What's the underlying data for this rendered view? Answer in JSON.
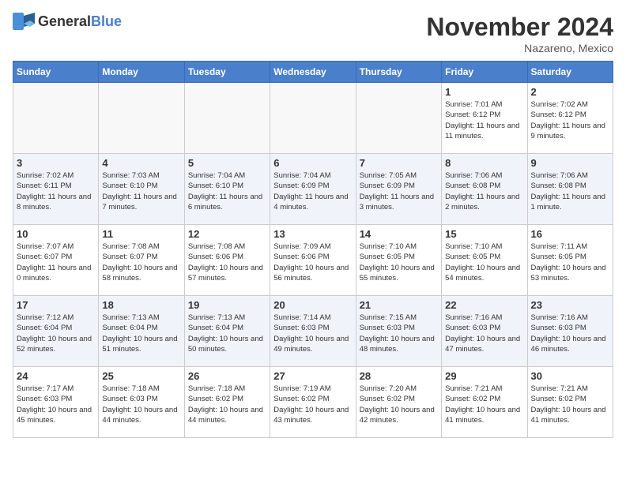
{
  "header": {
    "logo_general": "General",
    "logo_blue": "Blue",
    "month_title": "November 2024",
    "location": "Nazareno, Mexico"
  },
  "days_of_week": [
    "Sunday",
    "Monday",
    "Tuesday",
    "Wednesday",
    "Thursday",
    "Friday",
    "Saturday"
  ],
  "weeks": [
    [
      {
        "day": "",
        "info": ""
      },
      {
        "day": "",
        "info": ""
      },
      {
        "day": "",
        "info": ""
      },
      {
        "day": "",
        "info": ""
      },
      {
        "day": "",
        "info": ""
      },
      {
        "day": "1",
        "info": "Sunrise: 7:01 AM\nSunset: 6:12 PM\nDaylight: 11 hours and 11 minutes."
      },
      {
        "day": "2",
        "info": "Sunrise: 7:02 AM\nSunset: 6:12 PM\nDaylight: 11 hours and 9 minutes."
      }
    ],
    [
      {
        "day": "3",
        "info": "Sunrise: 7:02 AM\nSunset: 6:11 PM\nDaylight: 11 hours and 8 minutes."
      },
      {
        "day": "4",
        "info": "Sunrise: 7:03 AM\nSunset: 6:10 PM\nDaylight: 11 hours and 7 minutes."
      },
      {
        "day": "5",
        "info": "Sunrise: 7:04 AM\nSunset: 6:10 PM\nDaylight: 11 hours and 6 minutes."
      },
      {
        "day": "6",
        "info": "Sunrise: 7:04 AM\nSunset: 6:09 PM\nDaylight: 11 hours and 4 minutes."
      },
      {
        "day": "7",
        "info": "Sunrise: 7:05 AM\nSunset: 6:09 PM\nDaylight: 11 hours and 3 minutes."
      },
      {
        "day": "8",
        "info": "Sunrise: 7:06 AM\nSunset: 6:08 PM\nDaylight: 11 hours and 2 minutes."
      },
      {
        "day": "9",
        "info": "Sunrise: 7:06 AM\nSunset: 6:08 PM\nDaylight: 11 hours and 1 minute."
      }
    ],
    [
      {
        "day": "10",
        "info": "Sunrise: 7:07 AM\nSunset: 6:07 PM\nDaylight: 11 hours and 0 minutes."
      },
      {
        "day": "11",
        "info": "Sunrise: 7:08 AM\nSunset: 6:07 PM\nDaylight: 10 hours and 58 minutes."
      },
      {
        "day": "12",
        "info": "Sunrise: 7:08 AM\nSunset: 6:06 PM\nDaylight: 10 hours and 57 minutes."
      },
      {
        "day": "13",
        "info": "Sunrise: 7:09 AM\nSunset: 6:06 PM\nDaylight: 10 hours and 56 minutes."
      },
      {
        "day": "14",
        "info": "Sunrise: 7:10 AM\nSunset: 6:05 PM\nDaylight: 10 hours and 55 minutes."
      },
      {
        "day": "15",
        "info": "Sunrise: 7:10 AM\nSunset: 6:05 PM\nDaylight: 10 hours and 54 minutes."
      },
      {
        "day": "16",
        "info": "Sunrise: 7:11 AM\nSunset: 6:05 PM\nDaylight: 10 hours and 53 minutes."
      }
    ],
    [
      {
        "day": "17",
        "info": "Sunrise: 7:12 AM\nSunset: 6:04 PM\nDaylight: 10 hours and 52 minutes."
      },
      {
        "day": "18",
        "info": "Sunrise: 7:13 AM\nSunset: 6:04 PM\nDaylight: 10 hours and 51 minutes."
      },
      {
        "day": "19",
        "info": "Sunrise: 7:13 AM\nSunset: 6:04 PM\nDaylight: 10 hours and 50 minutes."
      },
      {
        "day": "20",
        "info": "Sunrise: 7:14 AM\nSunset: 6:03 PM\nDaylight: 10 hours and 49 minutes."
      },
      {
        "day": "21",
        "info": "Sunrise: 7:15 AM\nSunset: 6:03 PM\nDaylight: 10 hours and 48 minutes."
      },
      {
        "day": "22",
        "info": "Sunrise: 7:16 AM\nSunset: 6:03 PM\nDaylight: 10 hours and 47 minutes."
      },
      {
        "day": "23",
        "info": "Sunrise: 7:16 AM\nSunset: 6:03 PM\nDaylight: 10 hours and 46 minutes."
      }
    ],
    [
      {
        "day": "24",
        "info": "Sunrise: 7:17 AM\nSunset: 6:03 PM\nDaylight: 10 hours and 45 minutes."
      },
      {
        "day": "25",
        "info": "Sunrise: 7:18 AM\nSunset: 6:03 PM\nDaylight: 10 hours and 44 minutes."
      },
      {
        "day": "26",
        "info": "Sunrise: 7:18 AM\nSunset: 6:02 PM\nDaylight: 10 hours and 44 minutes."
      },
      {
        "day": "27",
        "info": "Sunrise: 7:19 AM\nSunset: 6:02 PM\nDaylight: 10 hours and 43 minutes."
      },
      {
        "day": "28",
        "info": "Sunrise: 7:20 AM\nSunset: 6:02 PM\nDaylight: 10 hours and 42 minutes."
      },
      {
        "day": "29",
        "info": "Sunrise: 7:21 AM\nSunset: 6:02 PM\nDaylight: 10 hours and 41 minutes."
      },
      {
        "day": "30",
        "info": "Sunrise: 7:21 AM\nSunset: 6:02 PM\nDaylight: 10 hours and 41 minutes."
      }
    ]
  ]
}
